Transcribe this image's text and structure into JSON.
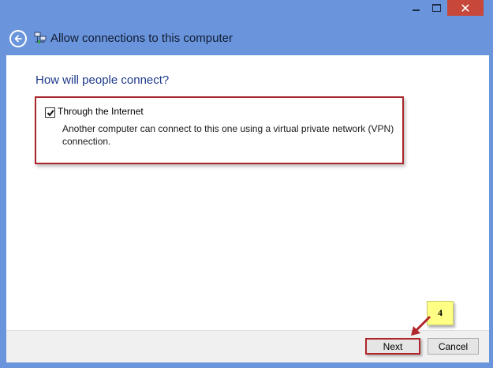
{
  "window": {
    "title": "Allow connections to this computer",
    "close_glyph": "✕"
  },
  "main": {
    "heading": "How will people connect?",
    "option": {
      "checked": true,
      "label": "Through the Internet",
      "description": "Another computer can connect to this one using a virtual private network (VPN) connection."
    }
  },
  "footer": {
    "next_label": "Next",
    "cancel_label": "Cancel"
  },
  "annotation": {
    "step": "4"
  },
  "colors": {
    "frame": "#6a95dc",
    "heading": "#1e3b8c",
    "highlight": "#a8252b",
    "callout": "#ffff85",
    "close": "#c7483b"
  }
}
